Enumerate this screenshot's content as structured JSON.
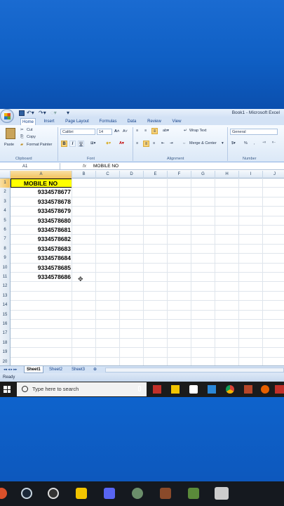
{
  "window": {
    "title": "Book1 - Microsoft Excel"
  },
  "ribbon": {
    "tabs": [
      "Home",
      "Insert",
      "Page Layout",
      "Formulas",
      "Data",
      "Review",
      "View"
    ],
    "active_tab": "Home",
    "clipboard": {
      "paste": "Paste",
      "cut": "Cut",
      "copy": "Copy",
      "format_painter": "Format Painter",
      "label": "Clipboard"
    },
    "font": {
      "name": "Calibri",
      "size": "14",
      "label": "Font",
      "bold": "B",
      "italic": "I",
      "underline": "U"
    },
    "alignment": {
      "wrap_text": "Wrap Text",
      "merge_center": "Merge & Center",
      "label": "Alignment"
    },
    "number": {
      "format": "General",
      "percent": "%",
      "label": "Number"
    }
  },
  "formula_bar": {
    "name_box": "A1",
    "fx": "fx",
    "content": "MOBILE NO"
  },
  "grid": {
    "columns": [
      "A",
      "B",
      "C",
      "D",
      "E",
      "F",
      "G",
      "H",
      "I",
      "J"
    ],
    "rows": [
      "1",
      "2",
      "3",
      "4",
      "5",
      "6",
      "7",
      "8",
      "9",
      "10",
      "11",
      "12",
      "13",
      "14",
      "15",
      "16",
      "17",
      "18",
      "19",
      "20"
    ],
    "column_a": [
      "MOBILE NO",
      "9334578677",
      "9334578678",
      "9334578679",
      "9334578680",
      "9334578681",
      "9334578682",
      "9334578683",
      "9334578684",
      "9334578685",
      "9334578686"
    ],
    "extra_rows": [
      "21",
      "22"
    ]
  },
  "sheets": [
    "Sheet1",
    "Sheet2",
    "Sheet3"
  ],
  "status": {
    "text": "Ready"
  },
  "taskbar": {
    "search_placeholder": "Type here to search"
  },
  "colors": {
    "header_fill": "#ffff00",
    "selection": "#f2c15c",
    "ribbon_blue": "#15428b"
  }
}
